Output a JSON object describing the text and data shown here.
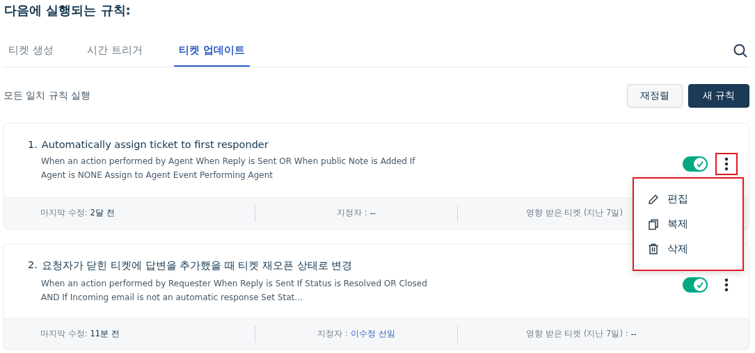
{
  "heading": "다음에 실행되는 규칙:",
  "tabs": [
    {
      "label": "티켓 생성",
      "selected": false
    },
    {
      "label": "시간 트리거",
      "selected": false
    },
    {
      "label": "티켓 업데이트",
      "selected": true
    }
  ],
  "run_mode": "모든 일치 규칙 실행",
  "buttons": [
    {
      "label": "재정렬",
      "kind": "secondary"
    },
    {
      "label": "새 규칙",
      "kind": "primary"
    }
  ],
  "rules": [
    {
      "number": "1.",
      "title": "Automatically assign ticket to first responder",
      "description": "When an action performed by Agent When Reply is Sent OR When public Note is Added If Agent is NONE Assign to Agent Event Performing Agent",
      "enabled": true,
      "menu_highlighted": true,
      "modified_label": "마지막 수정:",
      "modified_value": "2달 전",
      "assignee_label": "지정자 :",
      "assignee_value": "--",
      "assignee_link": false,
      "affected_label": "영향 받은 티켓 (지난 7일)"
    },
    {
      "number": "2.",
      "title": "요청자가 닫힌 티켓에 답변을 추가했을 때 티켓 재오픈 상태로 변경",
      "description": "When an action performed by Requester When Reply is Sent If Status is Resolved OR Closed AND If Incoming email is not an automatic response Set Stat...",
      "enabled": true,
      "menu_highlighted": false,
      "modified_label": "마지막 수정:",
      "modified_value": "11분 전",
      "assignee_label": "지정자 :",
      "assignee_value": "이수정 선임",
      "assignee_link": true,
      "affected_label": "영향 받은 티켓 (지난 7일) :",
      "affected_value": "--"
    }
  ],
  "menu": {
    "highlighted": true,
    "items": [
      {
        "label": "편집",
        "kind": "edit"
      },
      {
        "label": "복제",
        "kind": "copy"
      },
      {
        "label": "삭제",
        "kind": "delete"
      }
    ]
  }
}
